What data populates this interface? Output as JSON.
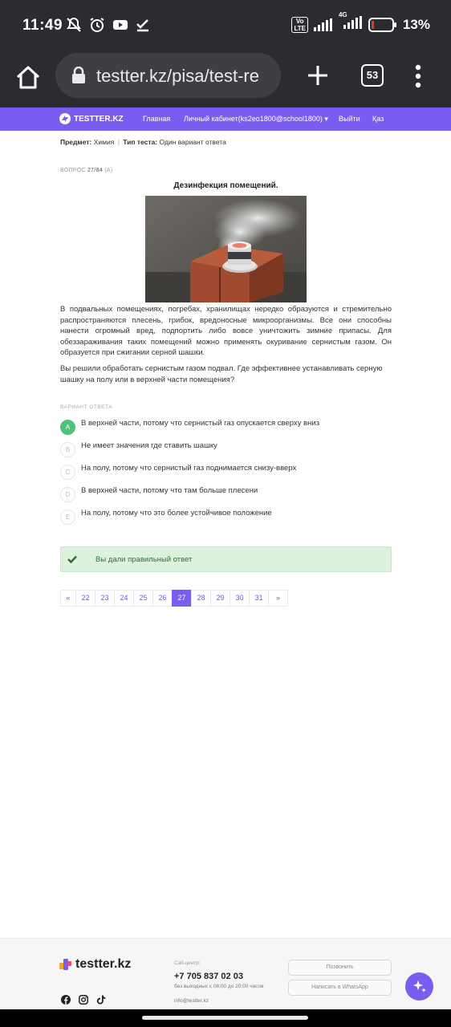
{
  "status_bar": {
    "time": "11:49",
    "volte": "Vo\nLTE",
    "network": "4G",
    "battery_pct": "13%",
    "battery_level": 0.13,
    "battery_color": "#e53935"
  },
  "browser": {
    "url": "testter.kz/pisa/test-re",
    "tab_count": "53"
  },
  "site_nav": {
    "brand": "TESTTER.KZ",
    "links": [
      "Главная",
      "Личный кабинет(ks2eo1800@school1800) ▾",
      "Выйти",
      "Қаз"
    ]
  },
  "test": {
    "subject_label": "Предмет:",
    "subject_value": "Химия",
    "type_label": "Тип теста:",
    "type_value": "Один вариант ответа",
    "question_prefix": "ВОПРОС",
    "question_number": "27/84",
    "question_suffix": "(А)",
    "title": "Дезинфекция помещений.",
    "text": "В подвальных помещениях, погребах, хранилищах нередко образуются и стремительно распространяются плесень, грибок, вредоносные микроорганизмы. Все они способны нанести огромный вред, подпортить либо вовсе уничтожить зимние припасы. Для обеззараживания таких помещений можно применять окуривание сернистым газом.  Он образуется при сжигании серной шашки.",
    "question": "Вы решили обработать сернистым газом подвал. Где эффективнее устанавливать серную шашку на полу или в верхней части помещения?",
    "answers_label": "ВАРИАНТ ОТВЕТА",
    "options": [
      {
        "letter": "A",
        "text": "В верхней части, потому что сернистый газ опускается сверху вниз"
      },
      {
        "letter": "B",
        "text": "Не имеет значения где ставить шашку"
      },
      {
        "letter": "C",
        "text": "На полу, потому что сернистый газ поднимается снизу-вверх"
      },
      {
        "letter": "D",
        "text": "В верхней части, потому что там больше плесени"
      },
      {
        "letter": "E",
        "text": "На полу, потому что это более устойчивое положение"
      }
    ],
    "result": "Вы дали правильный ответ",
    "accent_color": "#7b5cf0",
    "correct_color": "#4cc37a"
  },
  "pager": {
    "prev": "«",
    "pages": [
      "22",
      "23",
      "24",
      "25",
      "26",
      "27",
      "28",
      "29",
      "30",
      "31"
    ],
    "next": "»",
    "current": "27"
  },
  "footer": {
    "logo_text": "testter.kz",
    "call_center_label": "Call-центр:",
    "phone": "+7 705 837 02 03",
    "hours": "без выходных с 08:00 до 20:00 часов",
    "email": "info@testter.kz",
    "call_button": "Позвонить",
    "whatsapp_button": "Написать в WhatsApp",
    "social_icons": [
      "facebook-icon",
      "instagram-icon",
      "tiktok-icon"
    ]
  }
}
